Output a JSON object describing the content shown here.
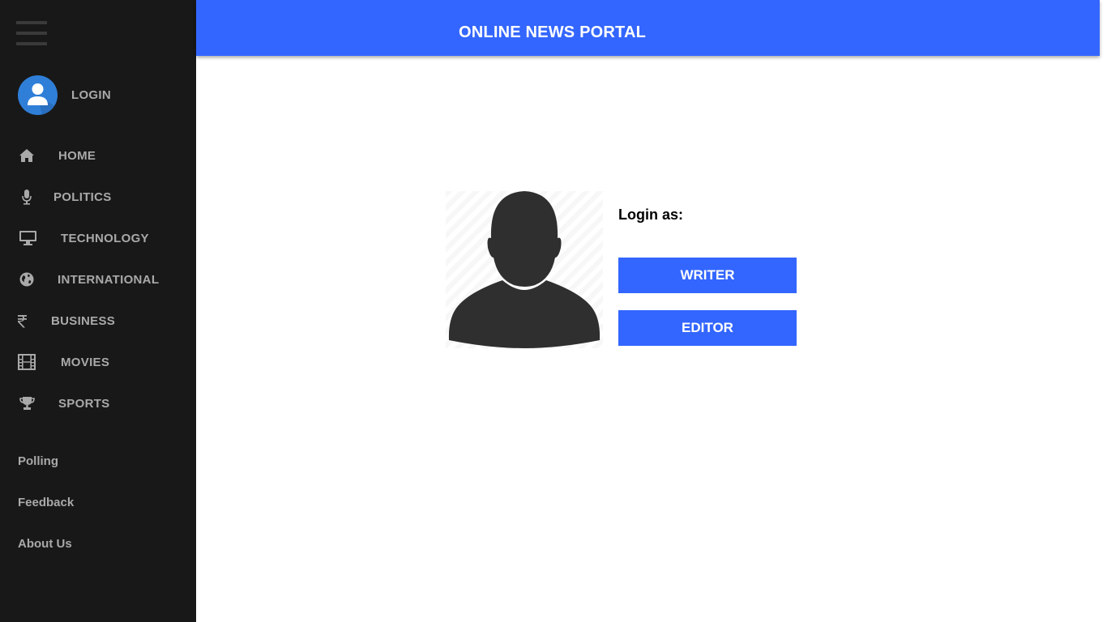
{
  "header": {
    "title": "ONLINE NEWS PORTAL"
  },
  "sidebar": {
    "menu_icon": "hamburger-icon",
    "login": {
      "label": "LOGIN",
      "icon": "user-avatar-icon"
    },
    "items": [
      {
        "label": "HOME",
        "icon": "home-icon"
      },
      {
        "label": "POLITICS",
        "icon": "microphone-icon"
      },
      {
        "label": "TECHNOLOGY",
        "icon": "desktop-icon"
      },
      {
        "label": "INTERNATIONAL",
        "icon": "globe-icon"
      },
      {
        "label": "BUSINESS",
        "icon": "rupee-icon"
      },
      {
        "label": "MOVIES",
        "icon": "film-icon"
      },
      {
        "label": "SPORTS",
        "icon": "trophy-icon"
      }
    ],
    "links": [
      {
        "label": "Polling"
      },
      {
        "label": "Feedback"
      },
      {
        "label": "About Us"
      }
    ]
  },
  "main": {
    "login_prompt": "Login as:",
    "buttons": {
      "writer": "WRITER",
      "editor": "EDITOR"
    },
    "profile_icon": "person-silhouette-icon"
  },
  "colors": {
    "accent": "#3366ff",
    "sidebar_bg": "#181818",
    "sidebar_text": "#a9a9a9",
    "avatar_bg": "#2f7fd8"
  }
}
